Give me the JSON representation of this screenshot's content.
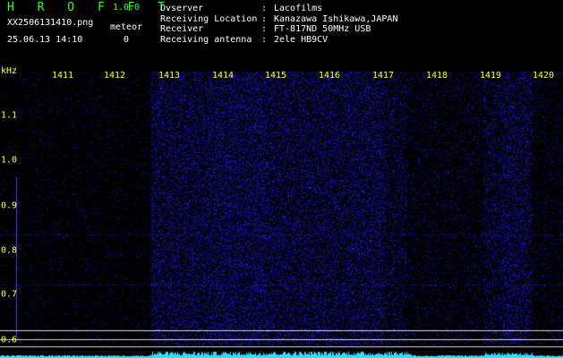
{
  "header": {
    "app_name": "H R O F F T",
    "app_version": "1.0.0",
    "filename": "XX2506131410.png",
    "datetime": "25.06.13 14:10",
    "meteor_label": "meteor",
    "meteor_count": "0"
  },
  "meta": [
    {
      "key": "Ovserver",
      "sep": ":",
      "value": "Lacofilms"
    },
    {
      "key": "Receiving Location",
      "sep": ":",
      "value": "Kanazawa Ishikawa,JAPAN"
    },
    {
      "key": "Receiver",
      "sep": ":",
      "value": "FT-817ND 50MHz USB"
    },
    {
      "key": "Receiving antenna",
      "sep": ":",
      "value": "2ele HB9CV"
    }
  ],
  "spectrogram": {
    "y_unit": "kHz",
    "x_ticks": [
      "1411",
      "1412",
      "1413",
      "1414",
      "1415",
      "1416",
      "1417",
      "1418",
      "1419",
      "1420"
    ],
    "y_ticks": [
      "1.1",
      "1.0",
      "0.9",
      "0.8",
      "0.7",
      "0.6"
    ],
    "colors": {
      "background": "#000000",
      "signal": "#1a1aff",
      "tick": "#ffff33",
      "trace": "#33ddff"
    }
  }
}
